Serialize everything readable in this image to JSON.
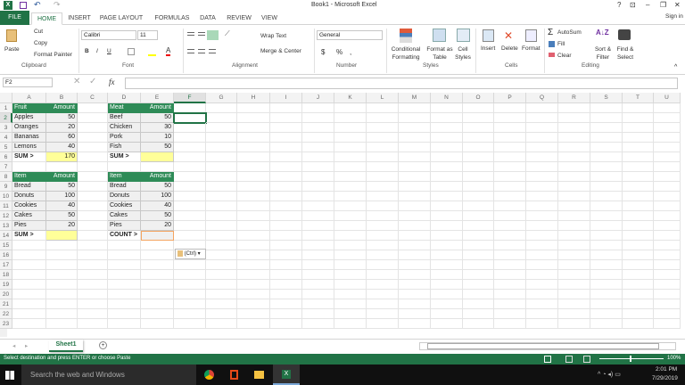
{
  "title": "Book1 - Microsoft Excel",
  "window_controls": [
    "?",
    "⊡",
    "–",
    "❐",
    "✕"
  ],
  "sign_in": "Sign in",
  "tabs": [
    "FILE",
    "HOME",
    "INSERT",
    "PAGE LAYOUT",
    "FORMULAS",
    "DATA",
    "REVIEW",
    "VIEW"
  ],
  "ribbon": {
    "clipboard": {
      "paste": "Paste",
      "cut": "Cut",
      "copy": "Copy",
      "format_painter": "Format Painter",
      "label": "Clipboard"
    },
    "font": {
      "name": "Calibri",
      "size": "11",
      "bold": "B",
      "italic": "I",
      "underline": "U",
      "label": "Font"
    },
    "alignment": {
      "wrap": "Wrap Text",
      "merge": "Merge & Center",
      "label": "Alignment"
    },
    "number": {
      "format": "General",
      "currency": "$",
      "percent": "%",
      "comma": ",",
      "label": "Number"
    },
    "styles": {
      "conditional": "Conditional Formatting",
      "format_table": "Format as Table",
      "cell_styles": "Cell Styles",
      "label": "Styles"
    },
    "cells": {
      "insert": "Insert",
      "delete": "Delete",
      "format": "Format",
      "label": "Cells"
    },
    "editing": {
      "autosum": "AutoSum",
      "fill": "Fill",
      "clear": "Clear",
      "sort": "Sort & Filter",
      "find": "Find & Select",
      "label": "Editing"
    }
  },
  "formula_bar": {
    "name_box": "F2",
    "fx": "fx",
    "value": ""
  },
  "columns": [
    "A",
    "B",
    "C",
    "D",
    "E",
    "F",
    "G",
    "H",
    "I",
    "J",
    "K",
    "L",
    "M",
    "N",
    "O",
    "P",
    "Q",
    "R",
    "S",
    "T",
    "U"
  ],
  "rows": [
    "1",
    "2",
    "3",
    "4",
    "5",
    "6",
    "7",
    "8",
    "9",
    "10",
    "11",
    "12",
    "13",
    "14",
    "15",
    "16",
    "17",
    "18",
    "19",
    "20",
    "21",
    "22",
    "23"
  ],
  "cells": {
    "A1": "Fruit",
    "B1": "Amount",
    "A2": "Apples",
    "B2": "50",
    "A3": "Oranges",
    "B3": "20",
    "A4": "Bananas",
    "B4": "60",
    "A5": "Lemons",
    "B5": "40",
    "A6": "SUM >",
    "B6": "170",
    "D1": "Meat",
    "E1": "Amount",
    "D2": "Beef",
    "E2": "50",
    "D3": "Chicken",
    "E3": "30",
    "D4": "Pork",
    "E4": "10",
    "D5": "Fish",
    "E5": "50",
    "D6": "SUM >",
    "E6": "",
    "A8": "Item",
    "B8": "Amount",
    "A9": "Bread",
    "B9": "50",
    "A10": "Donuts",
    "B10": "100",
    "A11": "Cookies",
    "B11": "40",
    "A12": "Cakes",
    "B12": "50",
    "A13": "Pies",
    "B13": "20",
    "A14": "SUM >",
    "B14": "",
    "D8": "Item",
    "E8": "Amount",
    "D9": "Bread",
    "E9": "50",
    "D10": "Donuts",
    "E10": "100",
    "D11": "Cookies",
    "E11": "40",
    "D12": "Cakes",
    "E12": "50",
    "D13": "Pies",
    "E13": "20",
    "D14": "COUNT >",
    "E14": ""
  },
  "selected_cell": "F2",
  "paste_options": "(Ctrl)",
  "sheet_tab": "Sheet1",
  "status_text": "Select destination and press ENTER or choose Paste",
  "zoom": "100%",
  "taskbar": {
    "search": "Search the web and Windows",
    "time": "2:01 PM",
    "date": "7/29/2019"
  },
  "colors": {
    "accent": "#217346",
    "header_fill": "#2e8b57",
    "sum_fill": "#ffff99"
  }
}
